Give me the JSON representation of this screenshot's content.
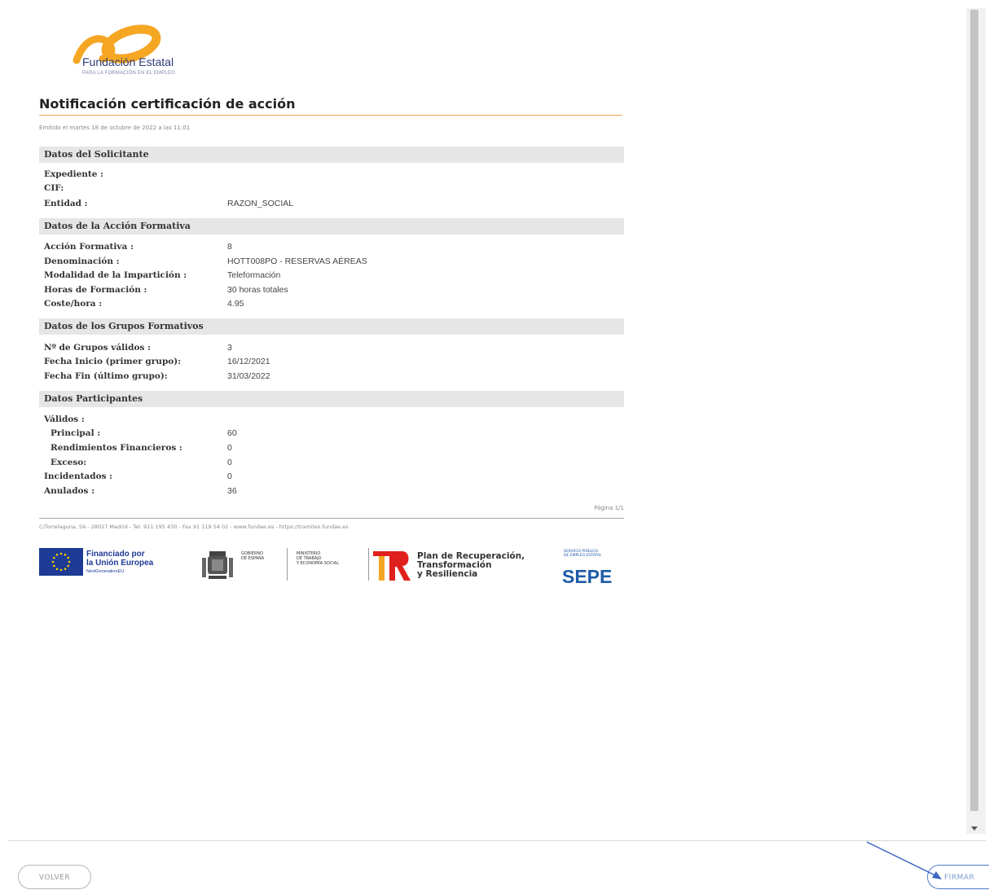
{
  "logo": {
    "name": "Fundación Estatal",
    "sub": "PARA LA FORMACIÓN EN EL EMPLEO"
  },
  "doc_title": "Notificación certificación de acción",
  "emitted": "Emitido el martes 18 de octubre de 2022 a las 11:01",
  "sections": {
    "solicitante": "Datos del Solicitante",
    "accion": "Datos de la Acción Formativa",
    "grupos": "Datos de los Grupos Formativos",
    "participantes": "Datos Participantes"
  },
  "solicitante": {
    "expediente_label": "Expediente :",
    "expediente_value": "",
    "cif_label": "CIF:",
    "cif_value": "",
    "entidad_label": "Entidad :",
    "entidad_value": "RAZON_SOCIAL"
  },
  "accion": {
    "accion_label": "Acción Formativa :",
    "accion_value": "8",
    "denominacion_label": "Denominación :",
    "denominacion_value": "HOTT008PO - RESERVAS AÉREAS",
    "modalidad_label": "Modalidad de la Impartición :",
    "modalidad_value": "Teleformación",
    "horas_label": "Horas de Formación :",
    "horas_value": "30 horas totales",
    "coste_label": "Coste/hora :",
    "coste_value": "4.95"
  },
  "grupos": {
    "validos_label": "Nº de Grupos válidos :",
    "validos_value": "3",
    "inicio_label": "Fecha Inicio (primer grupo):",
    "inicio_value": "16/12/2021",
    "fin_label": "Fecha Fin (último grupo):",
    "fin_value": "31/03/2022"
  },
  "participantes": {
    "validos_label": "Válidos :",
    "principal_label": "Principal :",
    "principal_value": "60",
    "rendimientos_label": "Rendimientos Financieros :",
    "rendimientos_value": "0",
    "exceso_label": "Exceso:",
    "exceso_value": "0",
    "incidentados_label": "Incidentados :",
    "incidentados_value": "0",
    "anulados_label": "Anulados :",
    "anulados_value": "36"
  },
  "page_num": "Página 1/1",
  "footer_text": "C/Torrelaguna, 56 - 28027 Madrid - Tel. 911 195 430 - Fax 91 119 54 02 - www.fundae.es - https://tramites.fundae.es",
  "logos": {
    "eu_line1": "Financiado por",
    "eu_line2": "la Unión Europea",
    "eu_line3": "NextGenerationEU",
    "gov_line1": "GOBIERNO",
    "gov_line2": "DE ESPAÑA",
    "min_line1": "MINISTERIO",
    "min_line2": "DE TRABAJO",
    "min_line3": "Y ECONOMÍA SOCIAL",
    "plan_line1": "Plan de Recuperación,",
    "plan_line2": "Transformación",
    "plan_line3": "y Resiliencia",
    "sepe_small1": "SERVICIO PÚBLICO",
    "sepe_small2": "DE EMPLEO ESTATAL",
    "sepe": "SEPE"
  },
  "buttons": {
    "volver": "VOLVER",
    "firmar": "FIRMAR"
  },
  "colors": {
    "accent_orange": "#f0a654",
    "logo_orange": "#f5a623",
    "eu_blue": "#1d3a95",
    "sepe_blue": "#1d5aa7",
    "tr_red": "#e0201d"
  }
}
